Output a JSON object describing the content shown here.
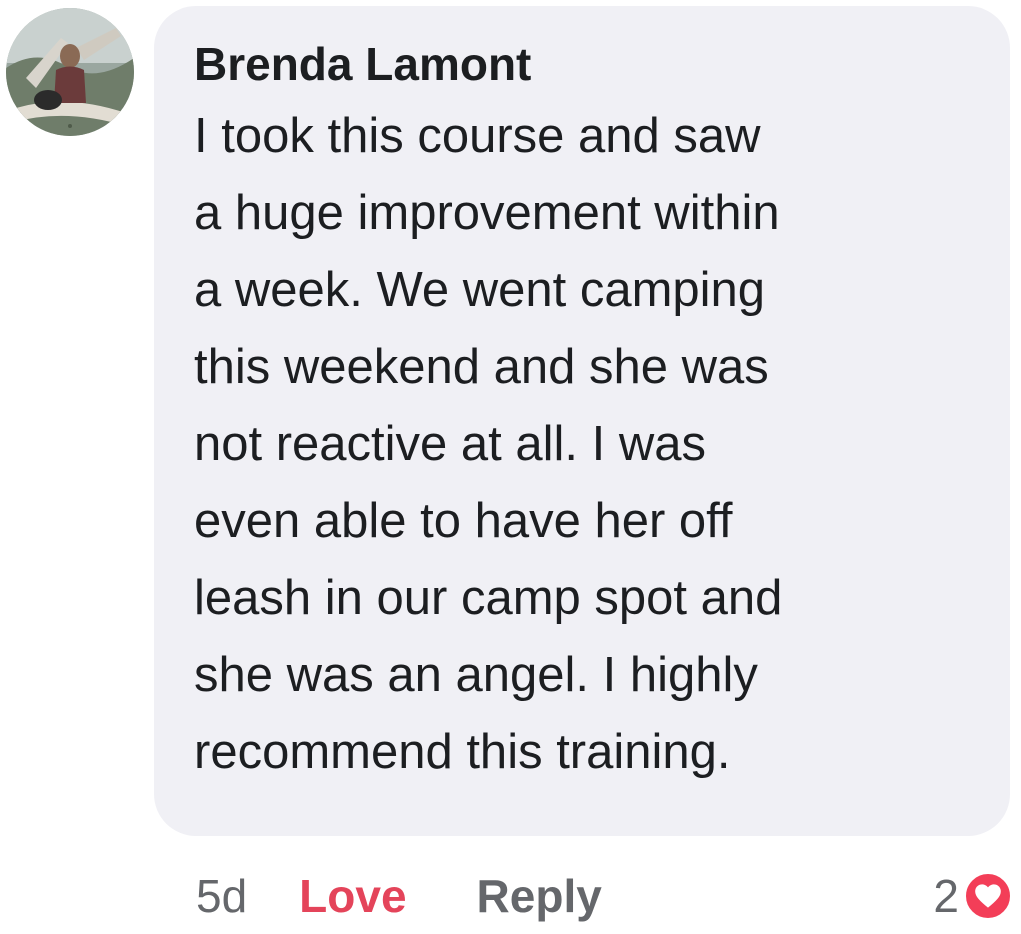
{
  "comment": {
    "author": "Brenda Lamont",
    "body_lines": [
      "I took this course and saw",
      "a huge improvement within",
      "a week. We went camping",
      "this weekend and she was",
      "not reactive at all. I was",
      "even able to have her off",
      "leash in our camp spot and",
      "she was an angel. I highly",
      "recommend this training."
    ],
    "time": "5d",
    "love_label": "Love",
    "reply_label": "Reply",
    "reaction_count": "2",
    "reaction_icon": "heart-icon"
  },
  "colors": {
    "bubble_bg": "#f0f0f5",
    "love": "#e4445a",
    "muted": "#65676b",
    "heart": "#f33e58"
  }
}
